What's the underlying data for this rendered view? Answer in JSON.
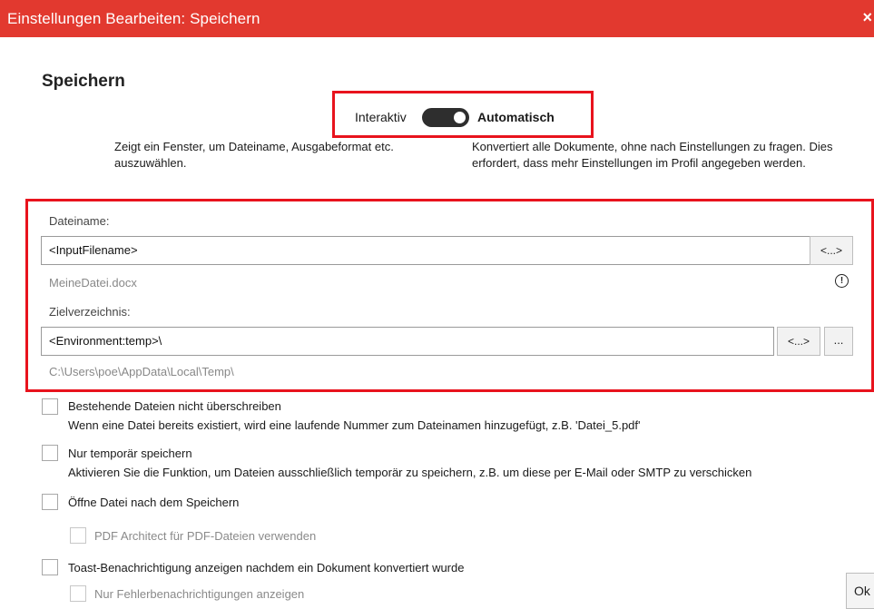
{
  "window": {
    "title": "Einstellungen Bearbeiten: Speichern",
    "close_glyph": "×"
  },
  "section": {
    "heading": "Speichern"
  },
  "mode_toggle": {
    "left_label": "Interaktiv",
    "right_label": "Automatisch",
    "state": "Automatisch",
    "desc_interactive": "Zeigt ein Fenster, um Dateiname, Ausgabeformat etc. auszuwählen.",
    "desc_automatic": "Konvertiert alle Dokumente, ohne nach Einstellungen zu fragen. Dies erfordert, dass mehr Einstellungen im Profil angegeben werden."
  },
  "filename": {
    "label": "Dateiname:",
    "value": "<InputFilename>",
    "token_button": "<...>",
    "preview": "MeineDatei.docx",
    "warning_glyph": "!"
  },
  "directory": {
    "label": "Zielverzeichnis:",
    "value": "<Environment:temp>\\",
    "token_button": "<...>",
    "browse_button": "...",
    "preview": "C:\\Users\\poe\\AppData\\Local\\Temp\\"
  },
  "options": [
    {
      "label": "Bestehende Dateien nicht überschreiben",
      "description": "Wenn eine Datei bereits existiert, wird eine laufende Nummer zum Dateinamen hinzugefügt, z.B. 'Datei_5.pdf'",
      "checked": false
    },
    {
      "label": "Nur temporär speichern",
      "description": "Aktivieren Sie die Funktion, um Dateien ausschließlich temporär zu speichern, z.B. um diese per E-Mail oder SMTP zu verschicken",
      "checked": false
    },
    {
      "label": "Öffne Datei nach dem Speichern",
      "checked": false
    },
    {
      "label": "PDF Architect für PDF-Dateien verwenden",
      "checked": false,
      "disabled": true
    },
    {
      "label": "Toast-Benachrichtigung anzeigen nachdem ein Dokument konvertiert wurde",
      "checked": false
    },
    {
      "label": "Nur Fehlerbenachrichtigungen anzeigen",
      "checked": false,
      "disabled": true
    }
  ],
  "footer": {
    "ok_label": "Ok"
  },
  "colors": {
    "titlebar": "#e2392f",
    "highlight": "#e8131d",
    "toggle": "#2e2e2e"
  }
}
